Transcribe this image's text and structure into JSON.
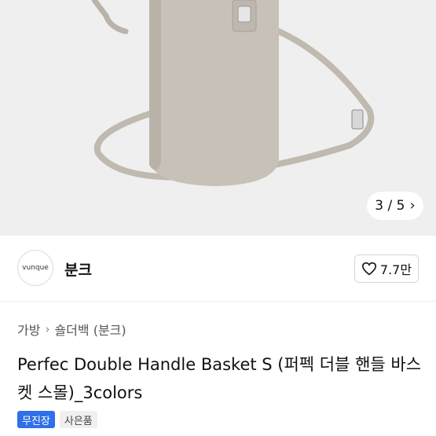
{
  "gallery": {
    "image_index": "3",
    "image_total": "5",
    "separator": "/",
    "next_icon": "chevron-right-icon"
  },
  "shop": {
    "logo_text": "vunque",
    "name": "분크",
    "like_count": "7.7만",
    "like_icon": "heart-outline-icon"
  },
  "breadcrumb": {
    "items": [
      "가방",
      "숄더백 (분크)"
    ],
    "separator_icon": "chevron-right-icon"
  },
  "product": {
    "title": "Perfec Double Handle Basket S (퍼펙 더블 핸들 바스켓 스몰)_3colors"
  },
  "tags": [
    "무진장",
    "사은품"
  ],
  "colors": {
    "tag_primary": "#2f6fe8",
    "hero_background": "#efefef",
    "bag_color": "#c7c1b8"
  }
}
